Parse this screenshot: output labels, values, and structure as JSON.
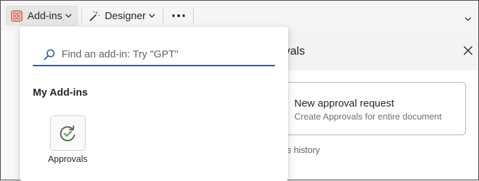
{
  "toolbar": {
    "addins_label": "Add-ins",
    "designer_label": "Designer",
    "more_label": "···"
  },
  "flyout": {
    "search_placeholder": "Find an add-in: Try \"GPT\"",
    "section_title": "My Add-ins",
    "addins": [
      {
        "label": "Approvals",
        "icon": "approvals-refresh-check-icon"
      }
    ]
  },
  "pane": {
    "title_visible": "ovals",
    "card_title": "New approval request",
    "card_subtitle": "Create Approvals for entire document",
    "history_visible": "als history"
  },
  "colors": {
    "accent_orange": "#d65a31",
    "search_underline": "#2b5797",
    "check_green": "#5aa55a"
  }
}
